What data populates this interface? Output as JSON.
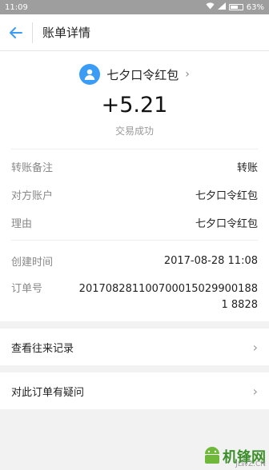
{
  "statusbar": {
    "time": "11:09",
    "battery": "63%",
    "battery_level": 0.63
  },
  "header": {
    "title": "账单详情"
  },
  "summary": {
    "counterparty": "七夕口令红包",
    "amount": "+5.21",
    "status": "交易成功"
  },
  "details": [
    {
      "key": "转账备注",
      "value": "转账"
    },
    {
      "key": "对方账户",
      "value": "七夕口令红包"
    },
    {
      "key": "理由",
      "value": "七夕口令红包"
    }
  ],
  "details2": [
    {
      "key": "创建时间",
      "value": "2017-08-28 11:08"
    },
    {
      "key": "订单号",
      "value": "2017082811007000150299001881 8828"
    }
  ],
  "links": [
    {
      "label": "查看往来记录"
    },
    {
      "label": "对此订单有疑问"
    }
  ],
  "watermark": {
    "text": "机锋网",
    "url": "JLWZ.CN"
  },
  "colors": {
    "accent": "#3b9cf5",
    "background": "#f2f2f2"
  }
}
